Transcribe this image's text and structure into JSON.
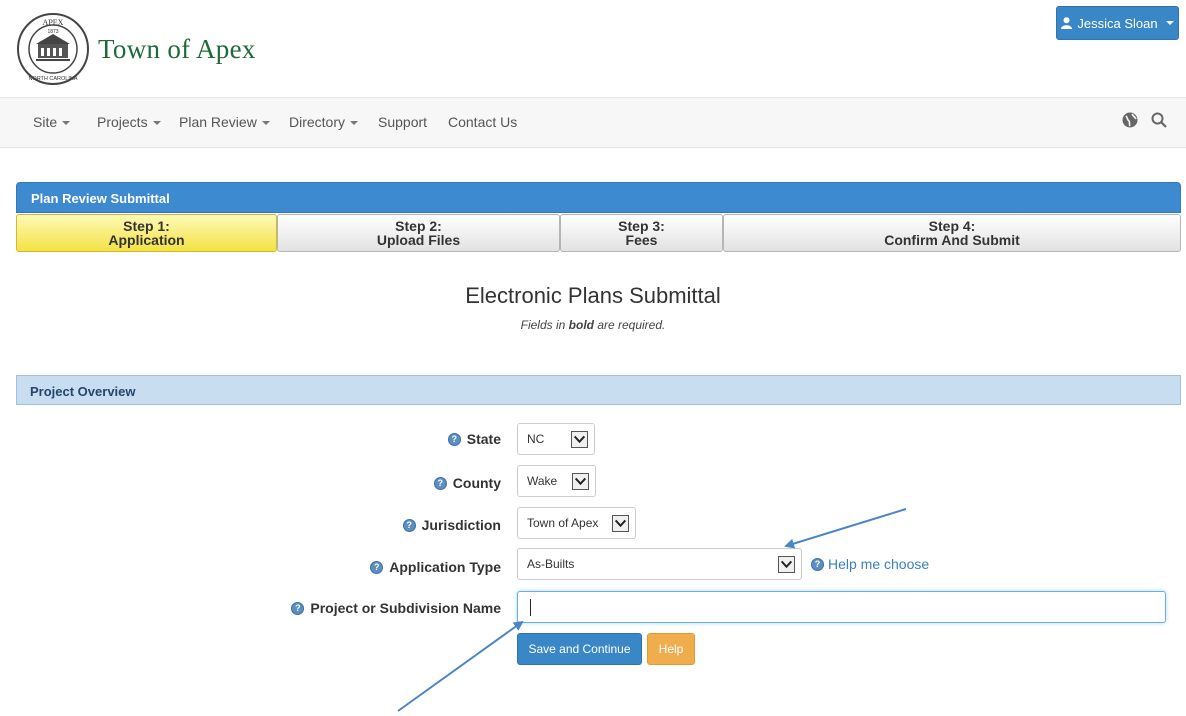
{
  "header": {
    "brand": "Town of Apex",
    "seal": {
      "top_text": "APEX",
      "year": "1873",
      "bottom_text": "NORTH CAROLINA"
    },
    "user_menu_label": "Jessica Sloan"
  },
  "nav": {
    "items": [
      {
        "label": "Site",
        "dropdown": true
      },
      {
        "label": "Projects",
        "dropdown": true
      },
      {
        "label": "Plan Review",
        "dropdown": true
      },
      {
        "label": "Directory",
        "dropdown": true
      },
      {
        "label": "Support",
        "dropdown": false
      },
      {
        "label": "Contact Us",
        "dropdown": false
      }
    ]
  },
  "panel": {
    "title": "Plan Review Submittal"
  },
  "steps": [
    {
      "line1": "Step 1:",
      "line2": "Application",
      "active": true
    },
    {
      "line1": "Step 2:",
      "line2": "Upload Files",
      "active": false
    },
    {
      "line1": "Step 3:",
      "line2": "Fees",
      "active": false
    },
    {
      "line1": "Step 4:",
      "line2": "Confirm And Submit",
      "active": false
    }
  ],
  "main": {
    "title": "Electronic Plans Submittal",
    "note_prefix": "Fields in ",
    "note_bold": "bold",
    "note_suffix": " are required."
  },
  "section": {
    "title": "Project Overview"
  },
  "form": {
    "state": {
      "label": "State",
      "value": "NC"
    },
    "county": {
      "label": "County",
      "value": "Wake"
    },
    "jurisdiction": {
      "label": "Jurisdiction",
      "value": "Town of Apex"
    },
    "application_type": {
      "label": "Application Type",
      "value": "As-Builts"
    },
    "help_me_choose": "Help me choose",
    "project_name": {
      "label": "Project or Subdivision Name",
      "value": ""
    }
  },
  "buttons": {
    "save_continue": "Save and Continue",
    "help": "Help"
  },
  "colors": {
    "brand_green": "#1f6a3a",
    "primary_blue": "#3a87c8",
    "active_step_yellow": "#f3e244",
    "help_orange": "#f0ad4e",
    "annotation_arrow": "#4a86c5"
  }
}
